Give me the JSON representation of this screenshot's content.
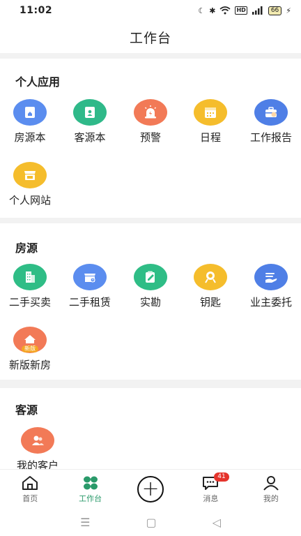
{
  "status_bar": {
    "time": "11:02",
    "battery": "66"
  },
  "header": {
    "title": "工作台"
  },
  "sections": {
    "personal": {
      "title": "个人应用",
      "items": [
        {
          "label": "房源本",
          "icon": "house-book-icon",
          "color": "#5b8def"
        },
        {
          "label": "客源本",
          "icon": "client-book-icon",
          "color": "#2fb989"
        },
        {
          "label": "预警",
          "icon": "alarm-icon",
          "color": "#f27a57"
        },
        {
          "label": "日程",
          "icon": "calendar-icon",
          "color": "#f5bd2c"
        },
        {
          "label": "工作报告",
          "icon": "briefcase-icon",
          "color": "#4f7fe6"
        },
        {
          "label": "个人网站",
          "icon": "storefront-icon",
          "color": "#f5bd2c"
        }
      ]
    },
    "housing": {
      "title": "房源",
      "items": [
        {
          "label": "二手买卖",
          "icon": "building-icon",
          "color": "#2fbd86"
        },
        {
          "label": "二手租赁",
          "icon": "rental-icon",
          "color": "#5b8def"
        },
        {
          "label": "实勘",
          "icon": "survey-icon",
          "color": "#2fbd86"
        },
        {
          "label": "钥匙",
          "icon": "key-icon",
          "color": "#f5bd2c"
        },
        {
          "label": "业主委托",
          "icon": "entrust-icon",
          "color": "#4f7fe6"
        },
        {
          "label": "新版新房",
          "icon": "new-house-icon",
          "color": "#f27a57",
          "tag": "新版"
        }
      ]
    },
    "clients": {
      "title": "客源",
      "items": [
        {
          "label": "我的客户",
          "icon": "my-clients-icon",
          "color": "#f27a57"
        }
      ]
    }
  },
  "tabbar": {
    "home": "首页",
    "workbench": "工作台",
    "messages": "消息",
    "messages_badge": "41",
    "mine": "我的",
    "active_color": "#2a9a6a"
  }
}
